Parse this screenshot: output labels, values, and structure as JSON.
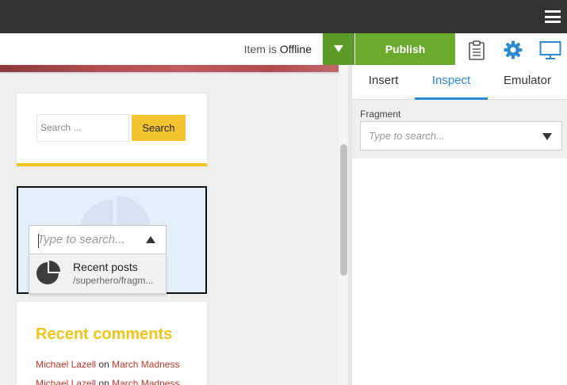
{
  "header": {
    "menu_icon": "hamburger-menu-icon"
  },
  "toolbar": {
    "status_prefix": "Item is",
    "status_value": "Offline",
    "publish_label": "Publish",
    "icons": [
      "clipboard-icon",
      "gear-icon",
      "monitor-icon"
    ],
    "colors": {
      "publish": "#6aaa2d",
      "accent": "#2f89d0"
    }
  },
  "preview": {
    "search_widget": {
      "placeholder": "Search ...",
      "button_label": "Search"
    },
    "fragment_picker": {
      "placeholder": "Type to search...",
      "result": {
        "title": "Recent posts",
        "path": "/superhero/fragm..."
      }
    },
    "comments": {
      "title": "Recent comments",
      "lines": [
        {
          "author": "Michael Lazell",
          "sep": "on",
          "post": "March Madness"
        },
        {
          "author": "Michael Lazell",
          "sep": "on",
          "post": "March Madness"
        }
      ]
    }
  },
  "panel": {
    "tabs": [
      {
        "label": "Insert"
      },
      {
        "label": "Inspect"
      },
      {
        "label": "Emulator"
      }
    ],
    "fragment": {
      "label": "Fragment",
      "placeholder": "Type to search..."
    }
  }
}
